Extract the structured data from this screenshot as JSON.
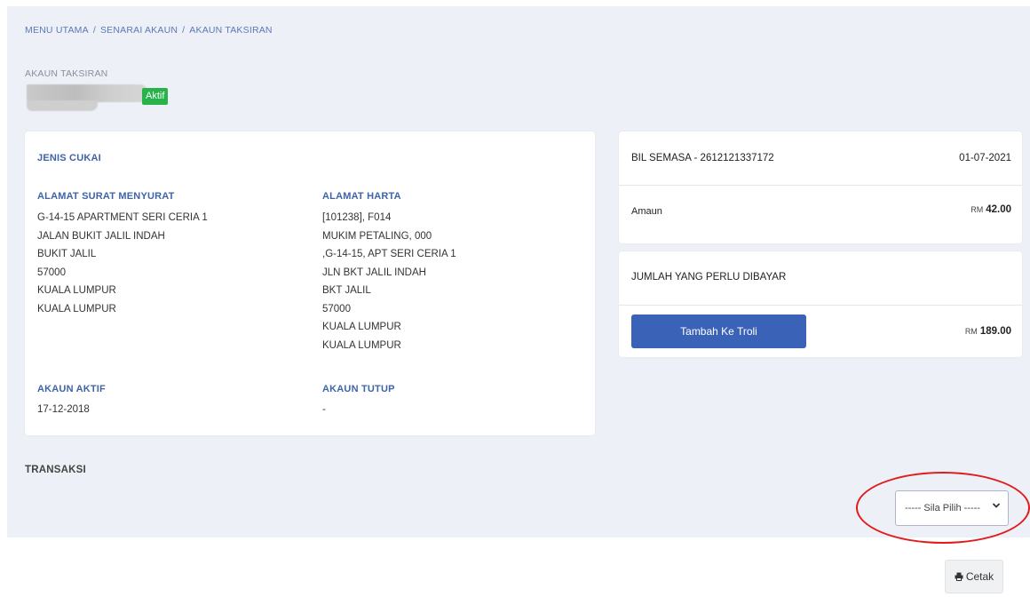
{
  "breadcrumb": {
    "items": [
      "MENU UTAMA",
      "SENARAI AKAUN",
      "AKAUN TAKSIRAN"
    ],
    "separator": "/"
  },
  "account": {
    "label": "AKAUN TAKSIRAN",
    "status": "Aktif"
  },
  "details": {
    "jenis_cukai_label": "JENIS CUKAI",
    "alamat_surat_label": "ALAMAT SURAT MENYURAT",
    "alamat_surat_lines": [
      "G-14-15 APARTMENT SERI CERIA 1",
      "JALAN BUKIT JALIL INDAH",
      "BUKIT JALIL",
      "57000",
      "KUALA LUMPUR",
      "KUALA LUMPUR"
    ],
    "alamat_harta_label": "ALAMAT HARTA",
    "alamat_harta_lines": [
      "[101238], F014",
      "MUKIM PETALING, 000",
      ",G-14-15, APT SERI CERIA 1",
      "JLN BKT JALIL INDAH",
      "BKT JALIL",
      "57000",
      "KUALA LUMPUR",
      "KUALA LUMPUR"
    ],
    "akaun_aktif_label": "AKAUN AKTIF",
    "akaun_aktif_value": "17-12-2018",
    "akaun_tutup_label": "AKAUN TUTUP",
    "akaun_tutup_value": "-"
  },
  "bil": {
    "title": "BIL SEMASA - 2612121337172",
    "date": "01-07-2021",
    "amount_label": "Amaun",
    "currency": "RM",
    "amount": "42.00"
  },
  "jumlah": {
    "title": "JUMLAH YANG PERLU DIBAYAR",
    "button_label": "Tambah Ke Troli",
    "currency": "RM",
    "amount": "189.00"
  },
  "transaksi": {
    "title": "TRANSAKSI",
    "select_value": "----- Sila Pilih -----",
    "print_label": "Cetak"
  },
  "colors": {
    "accent": "#3a63b8",
    "status_green": "#27b24a",
    "highlight_red": "#e01b1b"
  }
}
